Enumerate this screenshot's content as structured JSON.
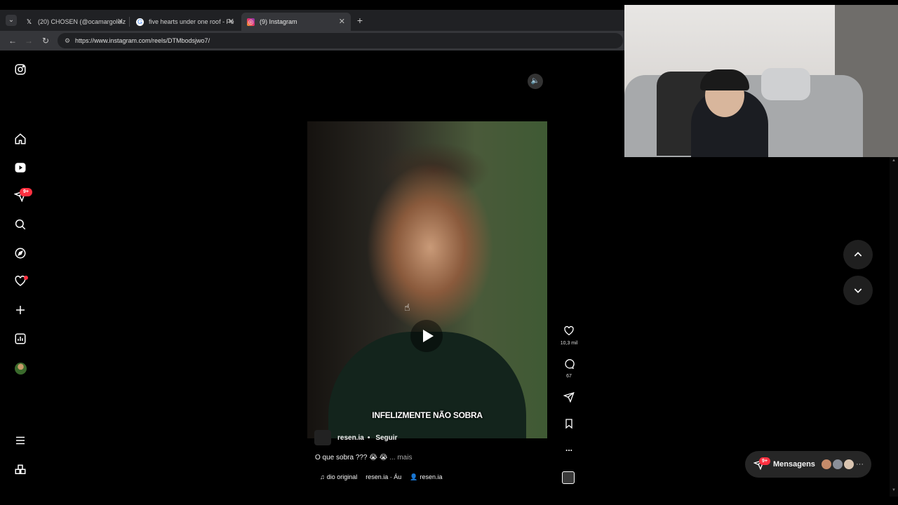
{
  "browser": {
    "tabs": [
      {
        "title": "(20) CHOSEN (@ocamargoluiz",
        "icon": "x-logo-icon",
        "active": false
      },
      {
        "title": "five hearts under one roof - Pe",
        "icon": "google-icon",
        "active": false
      },
      {
        "title": "(9) Instagram",
        "icon": "instagram-icon",
        "active": true
      }
    ],
    "new_tab": "+",
    "url": "https://www.instagram.com/reels/DTMbodsjwo7/"
  },
  "sidebar": {
    "items": [
      {
        "name": "home",
        "icon": "home-icon"
      },
      {
        "name": "reels",
        "icon": "reels-icon"
      },
      {
        "name": "messages",
        "icon": "send-icon"
      },
      {
        "name": "search",
        "icon": "search-icon"
      },
      {
        "name": "explore",
        "icon": "compass-icon"
      },
      {
        "name": "notifications",
        "icon": "heart-icon"
      },
      {
        "name": "create",
        "icon": "plus-icon"
      },
      {
        "name": "dashboard",
        "icon": "chart-icon"
      },
      {
        "name": "profile",
        "icon": "avatar-icon"
      }
    ],
    "messages_badge": "9+",
    "bottom": [
      {
        "name": "more",
        "icon": "menu-icon"
      },
      {
        "name": "also-from-meta",
        "icon": "grid-icon"
      }
    ]
  },
  "reel": {
    "subtitle": "INFELIZMENTE NÃO SOBRA",
    "username": "resen.ia",
    "separator": "•",
    "follow_label": "Seguir",
    "caption": "O que sobra ??? 😭 😭",
    "caption_more": "... mais",
    "audio_label": "dio original",
    "audio_author": "resen.ia · Áu",
    "tagged_user": "resen.ia",
    "likes": "10,3 mil",
    "comments": "67",
    "more_label": "..."
  },
  "messages_pill": {
    "label": "Mensagens",
    "badge": "9+",
    "more": "···"
  },
  "colors": {
    "background": "#000000",
    "accent_red": "#ff3040",
    "tab_active": "#35363a"
  }
}
